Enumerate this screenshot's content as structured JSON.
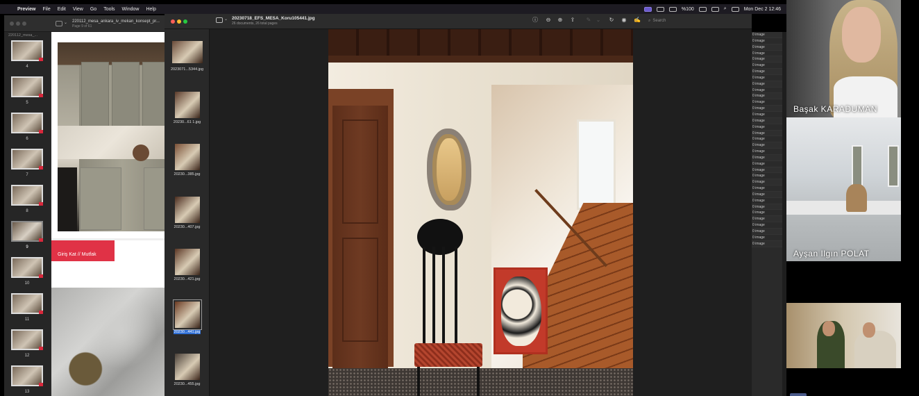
{
  "menubar": {
    "app": "Preview",
    "items": [
      "File",
      "Edit",
      "View",
      "Go",
      "Tools",
      "Window",
      "Help"
    ],
    "battery": "%100",
    "clock": "Mon Dec 2  12:46"
  },
  "bg_window": {
    "file_name": "220112_mesa_...",
    "title": "220112_mesa_ankara_iv_mekan_konsept_pr...",
    "subtitle": "Page 9 of 61",
    "pages": [
      "4",
      "5",
      "6",
      "7",
      "8",
      "9",
      "10",
      "11",
      "12",
      "13"
    ],
    "selected_page": "9",
    "section_label": "Giriş Kat // Mutfak"
  },
  "main_window": {
    "title": "20230718_EFS_MESA_Koru105441.jpg",
    "subtitle": "26 documents, 26 total pages",
    "search_placeholder": "Search",
    "thumbnails": [
      {
        "name": "2023071...5344.jpg",
        "selected": false
      },
      {
        "name": "20230...61 1.jpg",
        "selected": false
      },
      {
        "name": "20230...385.jpg",
        "selected": false
      },
      {
        "name": "20230...407.jpg",
        "selected": false
      },
      {
        "name": "20230...421.jpg",
        "selected": false
      },
      {
        "name": "20230...441.jpg",
        "selected": true
      },
      {
        "name": "20230...455.jpg",
        "selected": false
      }
    ]
  },
  "file_list": {
    "row_label": "image",
    "row_count": 35
  },
  "participants": [
    {
      "name": "Başak KARADUMAN"
    },
    {
      "name": "Ayşan Ilgın POLAT"
    }
  ]
}
